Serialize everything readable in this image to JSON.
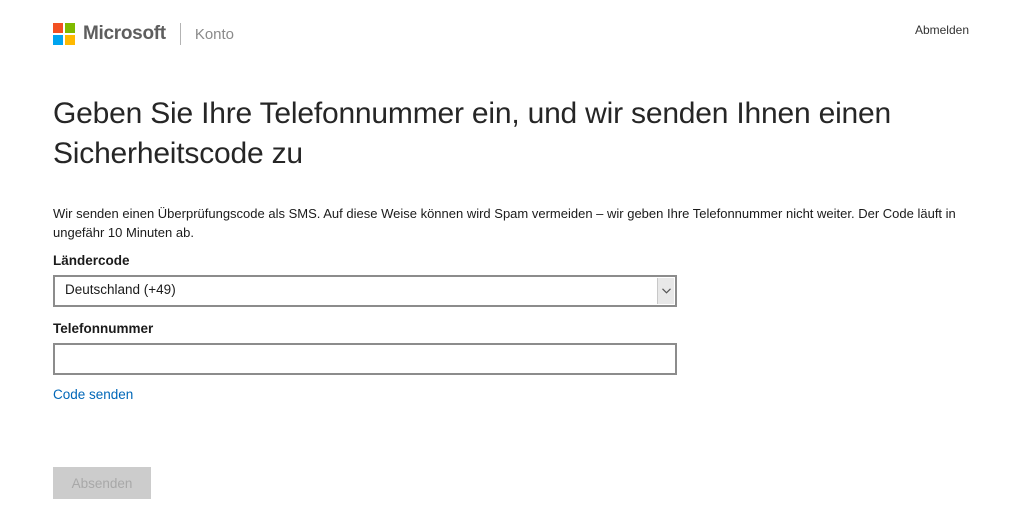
{
  "header": {
    "brand_name": "Microsoft",
    "section": "Konto",
    "signout_label": "Abmelden",
    "logo_colors": [
      "#f25022",
      "#7fba00",
      "#00a4ef",
      "#ffb900"
    ]
  },
  "main": {
    "title": "Geben Sie Ihre Telefonnummer ein, und wir senden Ihnen einen Sicherheitscode zu",
    "description": "Wir senden einen Überprüfungscode als SMS. Auf diese Weise können wird Spam vermeiden – wir geben Ihre Telefonnummer nicht weiter. Der Code läuft in ungefähr 10 Minuten ab.",
    "country_code": {
      "label": "Ländercode",
      "selected": "Deutschland (+49)"
    },
    "phone": {
      "label": "Telefonnummer",
      "value": "",
      "placeholder": ""
    },
    "send_code_label": "Code senden",
    "submit_label": "Absenden"
  },
  "colors": {
    "link": "#0067b8",
    "disabled_button_bg": "#cccccc",
    "disabled_button_text": "#a8a8a8"
  },
  "icons": {
    "select_arrow": "chevron-down-icon",
    "logo": "microsoft-logo-icon"
  }
}
